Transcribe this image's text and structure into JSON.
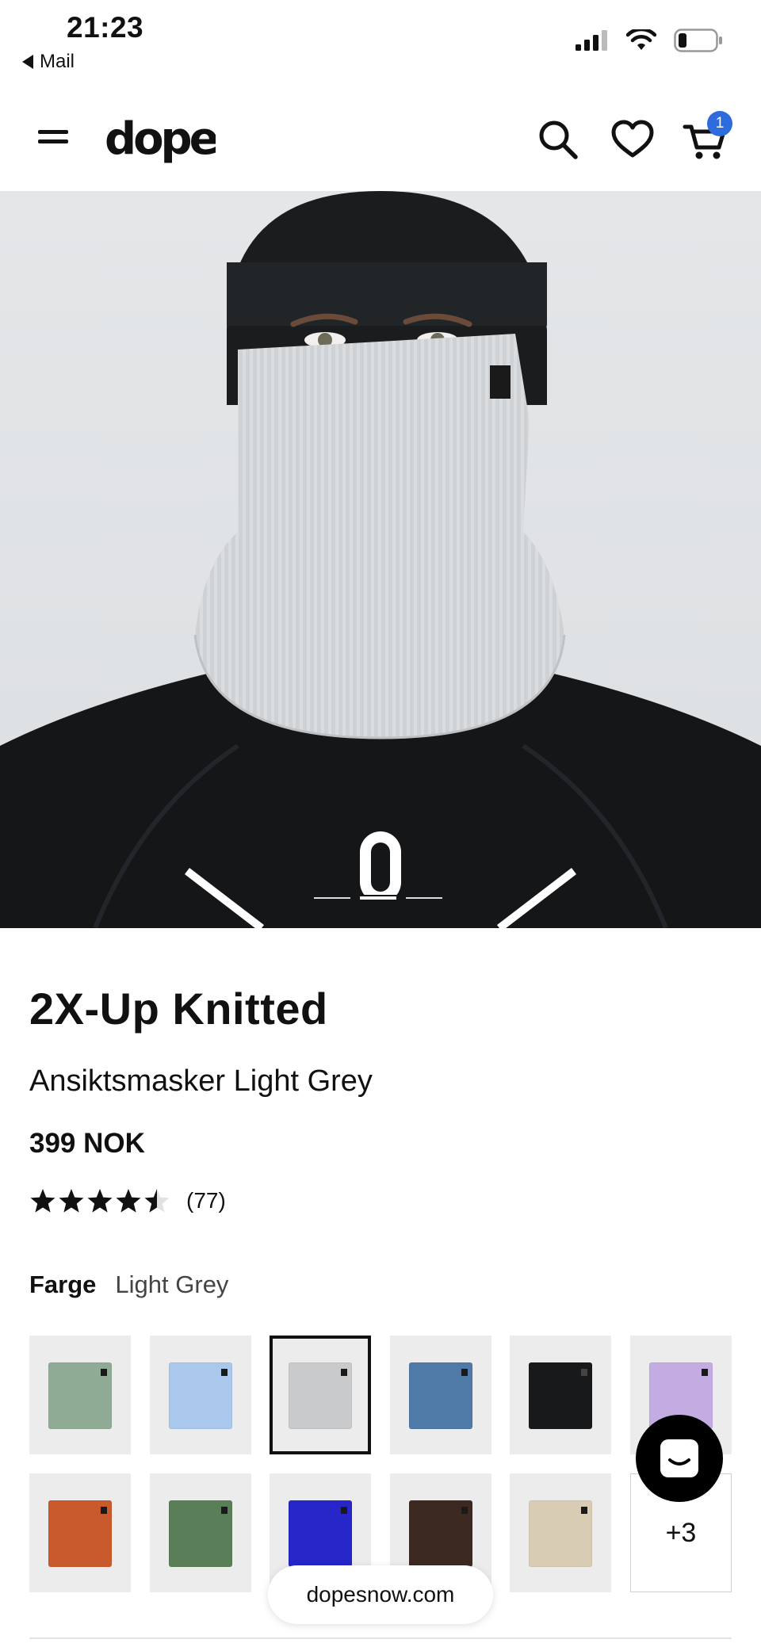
{
  "status_bar": {
    "time": "21:23",
    "back_app": "Mail",
    "icons": [
      "signal-icon",
      "wifi-icon",
      "battery-icon"
    ]
  },
  "header": {
    "logo_text": "dope",
    "icons": [
      "menu-icon",
      "search-icon",
      "heart-icon",
      "cart-icon"
    ],
    "cart_count": "1",
    "badge_color": "#2e6bdc"
  },
  "hero": {
    "pagination": {
      "total": 3,
      "active": 2
    }
  },
  "product": {
    "title": "2X-Up Knitted",
    "subtitle": "Ansiktsmasker Light Grey",
    "price": "399 NOK",
    "rating": {
      "value": 4.5,
      "max": 5,
      "count": "(77)"
    },
    "color_label": "Farge",
    "color_value": "Light Grey"
  },
  "swatches": [
    {
      "color": "#8fab95",
      "selected": false
    },
    {
      "color": "#a9c8ec",
      "selected": false
    },
    {
      "color": "#c8cacc",
      "selected": true
    },
    {
      "color": "#4f79a6",
      "selected": false
    },
    {
      "color": "#17191b",
      "selected": false
    },
    {
      "color": "#c2ace2",
      "selected": false
    },
    {
      "color": "#c95a2d",
      "selected": false
    },
    {
      "color": "#5a7f58",
      "selected": false
    },
    {
      "color": "#2626c9",
      "selected": false
    },
    {
      "color": "#3c2a22",
      "selected": false
    },
    {
      "color": "#d8ccb4",
      "selected": false
    }
  ],
  "more_swatches_label": "+3",
  "chat_icon": "chat-icon",
  "browser": {
    "url": "dopesnow.com"
  }
}
